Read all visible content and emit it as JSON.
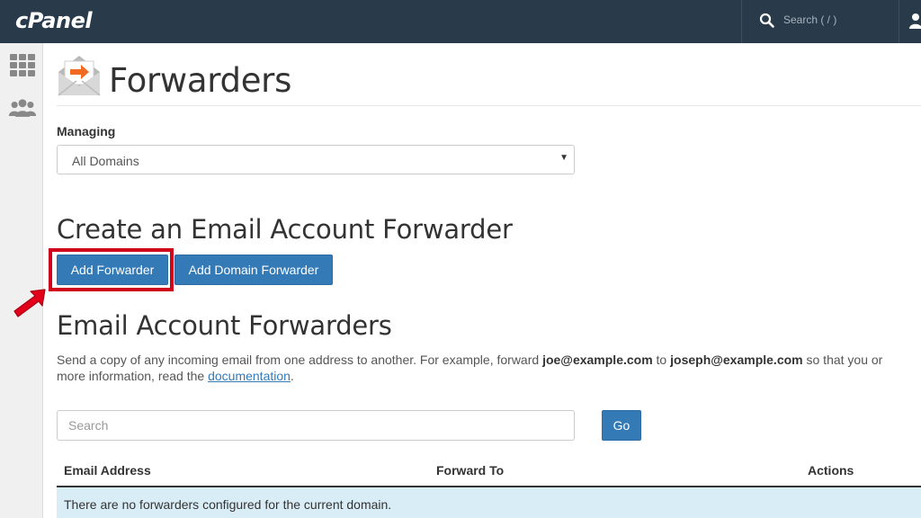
{
  "topbar": {
    "logo": "cPanel",
    "search_placeholder": "Search ( / )"
  },
  "page": {
    "title": "Forwarders"
  },
  "managing": {
    "label": "Managing",
    "selected": "All Domains"
  },
  "create": {
    "heading": "Create an Email Account Forwarder",
    "add_forwarder": "Add Forwarder",
    "add_domain_forwarder": "Add Domain Forwarder"
  },
  "list": {
    "heading": "Email Account Forwarders",
    "desc_1": "Send a copy of any incoming email from one address to another. For example, forward ",
    "desc_email_1": "joe@example.com",
    "desc_2": " to ",
    "desc_email_2": "joseph@example.com",
    "desc_3": " so that you or",
    "desc_4": "more information, read the ",
    "desc_link": "documentation",
    "desc_5": ".",
    "search_placeholder": "Search",
    "go_label": "Go"
  },
  "table": {
    "columns": [
      "Email Address",
      "Forward To",
      "Actions"
    ],
    "empty_message": "There are no forwarders configured for the current domain."
  },
  "colors": {
    "topbar": "#293a4a",
    "primary": "#337ab7",
    "highlight": "#d0021b",
    "empty_row": "#d9edf7"
  },
  "icons": {
    "topbar_search": "search-icon",
    "topbar_user": "user-icon",
    "sidebar_1": "grid-icon",
    "sidebar_2": "users-icon",
    "page": "forwarder-envelope-icon",
    "select_caret": "caret-down-icon",
    "callout": "arrow-icon"
  }
}
